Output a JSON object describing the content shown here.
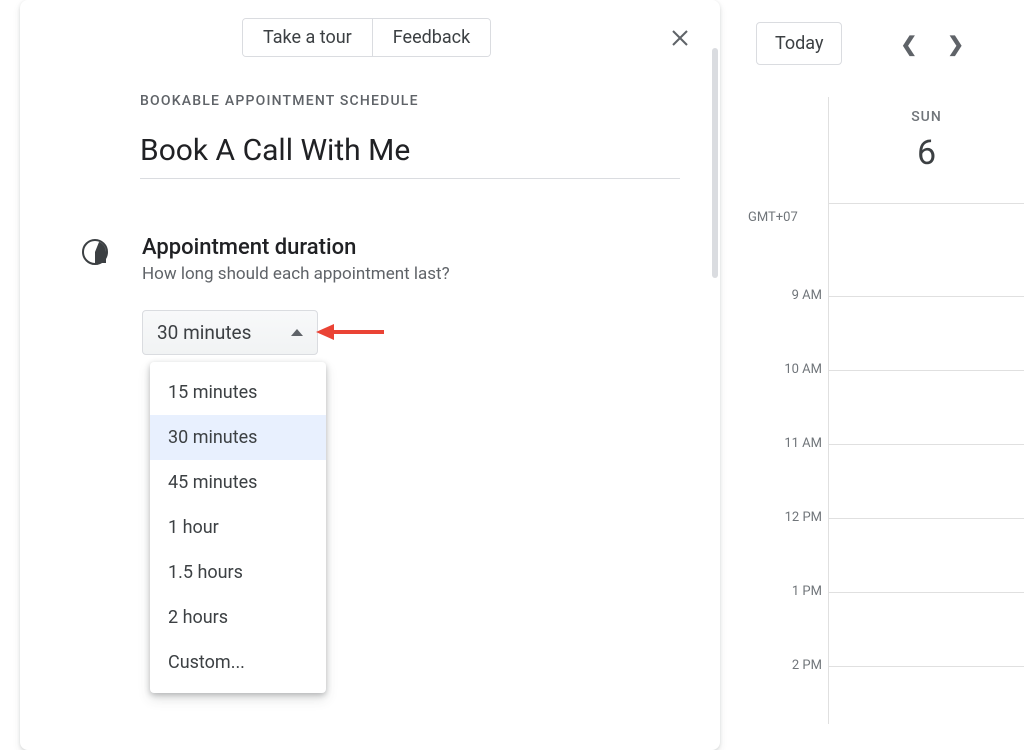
{
  "panel": {
    "take_tour": "Take a tour",
    "feedback": "Feedback",
    "overline": "BOOKABLE APPOINTMENT SCHEDULE",
    "title": "Book A Call With Me",
    "duration": {
      "label": "Appointment duration",
      "sub": "How long should each appointment last?",
      "selected": "30 minutes",
      "options": [
        "15 minutes",
        "30 minutes",
        "45 minutes",
        "1 hour",
        "1.5 hours",
        "2 hours",
        "Custom..."
      ]
    }
  },
  "calendar": {
    "today": "Today",
    "timezone": "GMT+07",
    "day_of_week": "SUN",
    "day_of_month": "6",
    "hours": [
      "9 AM",
      "10 AM",
      "11 AM",
      "12 PM",
      "1 PM",
      "2 PM"
    ]
  }
}
